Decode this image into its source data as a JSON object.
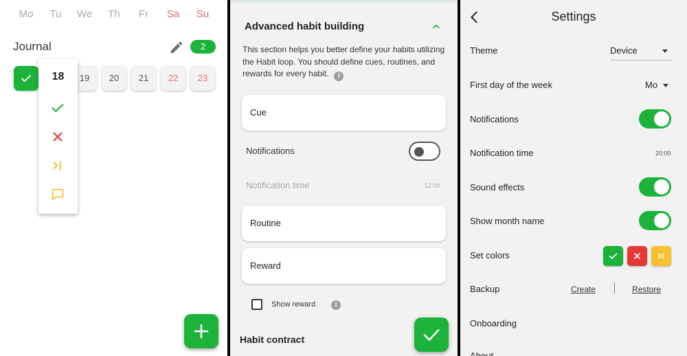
{
  "calendar": {
    "weekdays": [
      "Mo",
      "Tu",
      "We",
      "Th",
      "Fr",
      "Sa",
      "Su"
    ],
    "habit_title": "Journal",
    "habit_count": "2",
    "days": [
      "18",
      "19",
      "20",
      "21",
      "22",
      "23"
    ],
    "popup_day": "18"
  },
  "habit_edit": {
    "section_title": "Advanced habit building",
    "section_description": "This section helps you better define your habits utilizing the Habit loop. You should define cues, routines, and rewards for every habit.",
    "cue_label": "Cue",
    "notifications_label": "Notifications",
    "notification_time_label": "Notification time",
    "notification_time_value": "12:00",
    "routine_label": "Routine",
    "reward_label": "Reward",
    "show_reward_label": "Show reward",
    "habit_contract_title": "Habit contract"
  },
  "settings": {
    "title": "Settings",
    "theme_label": "Theme",
    "theme_value": "Device",
    "first_day_label": "First day of the week",
    "first_day_value": "Mo",
    "notifications_label": "Notifications",
    "notification_time_label": "Notification time",
    "notification_time_value": "20:00",
    "sound_effects_label": "Sound effects",
    "show_month_name_label": "Show month name",
    "set_colors_label": "Set colors",
    "backup_label": "Backup",
    "create_label": "Create",
    "restore_label": "Restore",
    "onboarding_label": "Onboarding",
    "about_label": "About"
  },
  "colors": {
    "done": "#1db33a",
    "fail": "#e53935",
    "skip": "#fbc02d",
    "weekend_text": "#e57373"
  }
}
